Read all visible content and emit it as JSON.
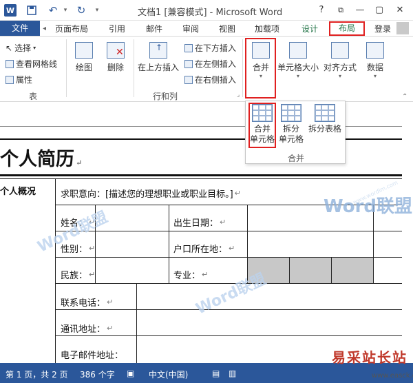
{
  "titlebar": {
    "app_icon": "W",
    "title": "文档1 [兼容模式] - Microsoft Word",
    "help": "?",
    "minimize": "—",
    "restore": "▢",
    "close": "✕"
  },
  "tabs": {
    "file": "文件",
    "items": [
      "页面布局",
      "引用",
      "邮件",
      "审阅",
      "视图",
      "加载项",
      "设计"
    ],
    "active": "布局",
    "login": "登录"
  },
  "ribbon": {
    "table_group": {
      "select": "选择",
      "gridlines": "查看网格线",
      "properties": "属性",
      "label": "表"
    },
    "draw": "绘图",
    "delete": "删除",
    "insert_above": "在上方插入",
    "insert_below": "在下方插入",
    "insert_left": "在左侧插入",
    "insert_right": "在右侧插入",
    "rows_cols_label": "行和列",
    "merge": "合并",
    "cell_size": "单元格大小",
    "alignment": "对齐方式",
    "data": "数据"
  },
  "merge_dropdown": {
    "merge_cells": [
      "合并",
      "单元格"
    ],
    "split_cells": [
      "拆分",
      "单元格"
    ],
    "split_table": "拆分表格",
    "group_label": "合并"
  },
  "document": {
    "title": "个人简历",
    "section": "个人概况",
    "objective": "求职意向：[描述您的理想职业或职业目标。]",
    "name": "姓名：",
    "birth": "出生日期：",
    "gender": "性别：",
    "hukou": "户口所在地：",
    "ethnicity": "民族：",
    "major": "专业：",
    "phone": "联系电话：",
    "address": "通讯地址：",
    "email": "电子邮件地址："
  },
  "statusbar": {
    "page": "第 1 页，共 2 页",
    "words": "386 个字",
    "language": "中文(中国)"
  },
  "watermark": {
    "brand": "Word联盟",
    "url": "www.wordlm.com"
  },
  "corner": {
    "brand": "易采站长站",
    "url": "www.easck.com"
  },
  "colors": {
    "word_blue": "#2b579a",
    "highlight_red": "#e02020",
    "table_tools_green": "#217346"
  }
}
